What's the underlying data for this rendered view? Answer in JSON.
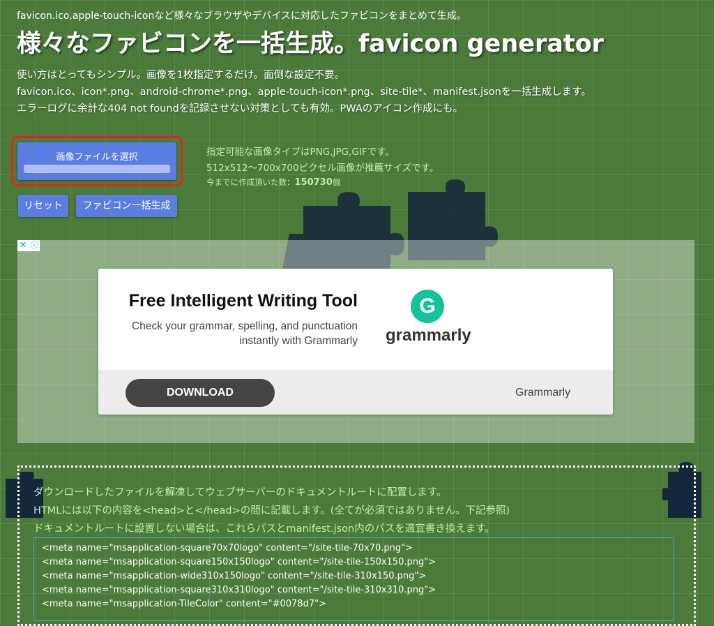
{
  "header": {
    "subtitle": "favicon.ico,apple-touch-iconなど様々なブラウザやデバイスに対応したファビコンをまとめて生成。",
    "title": "様々なファビコンを一括生成。favicon generator"
  },
  "intro": [
    "使い方はとってもシンプル。画像を1枚指定するだけ。面倒な設定不要。",
    "favicon.ico、icon*.png、android-chrome*.png、apple-touch-icon*.png、site-tile*、manifest.jsonを一括生成します。",
    "エラーログに余計な404 not foundを記録させない対策としても有効。PWAのアイコン作成にも。"
  ],
  "controls": {
    "file_button_label": "画像ファイルを選択",
    "file_progress": 0,
    "reset_label": "リセット",
    "generate_label": "ファビコン一括生成"
  },
  "info": {
    "line1": "指定可能な画像タイプはPNG,JPG,GIFです。",
    "line2": "512x512〜700x700ピクセル画像が推薦サイズです。",
    "count_prefix": "今までに作成頂いた数：",
    "count_value": "150730",
    "count_suffix": "個"
  },
  "ad": {
    "close_icon": "✕",
    "info_icon": "ⓘ",
    "headline": "Free Intelligent Writing Tool",
    "body": "Check your grammar, spelling, and punctuation instantly with Grammarly",
    "brand": "grammarly",
    "logo_letter": "G",
    "download_label": "DOWNLOAD",
    "advertiser": "Grammarly",
    "accent": "#15c39a"
  },
  "guide": [
    "ダウンロードしたファイルを解凍してウェブサーバーのドキュメントルートに配置します。",
    "HTMLには以下の内容を<head>と</head>の間に記載します。(全てが必須ではありません。下記参照)",
    "ドキュメントルートに設置しない場合は、これらパスとmanifest.json内のパスを適宜書き換えます。"
  ],
  "code": [
    "<meta name=\"msapplication-square70x70logo\" content=\"/site-tile-70x70.png\">",
    "<meta name=\"msapplication-square150x150logo\" content=\"/site-tile-150x150.png\">",
    "<meta name=\"msapplication-wide310x150logo\" content=\"/site-tile-310x150.png\">",
    "<meta name=\"msapplication-square310x310logo\" content=\"/site-tile-310x310.png\">",
    "<meta name=\"msapplication-TileColor\" content=\"#0078d7\">"
  ],
  "colors": {
    "background": "#4b7a3a",
    "button": "#5b7de0",
    "info_text": "#bff2a8",
    "highlight_frame": "#e0261e"
  }
}
